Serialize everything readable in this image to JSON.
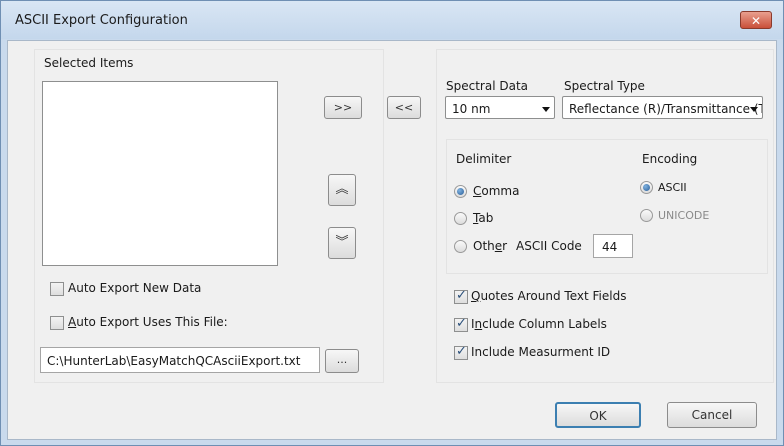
{
  "window": {
    "title": "ASCII Export Configuration",
    "close_glyph": "✕"
  },
  "selected_items": {
    "label": "Selected Items"
  },
  "buttons": {
    "add": ">>",
    "remove": "<<",
    "move_up_glyph": "︽",
    "move_down_glyph": "︾",
    "browse": "...",
    "ok": "OK",
    "cancel": "Cancel"
  },
  "auto_export_new_data": {
    "label": "Auto Export New Data",
    "checked": false
  },
  "auto_export_uses_file": {
    "label_accel": "A",
    "label_rest": "uto Export Uses This File:",
    "checked": false
  },
  "file_path": "C:\\HunterLab\\EasyMatchQCAsciiExport.txt",
  "spectral_data": {
    "label": "Spectral Data",
    "value": "10 nm"
  },
  "spectral_type": {
    "label": "Spectral Type",
    "value": "Reflectance (R)/Transmittance (T)"
  },
  "delimiter": {
    "label": "Delimiter",
    "comma": {
      "accel": "C",
      "rest": "omma",
      "selected": true
    },
    "tab": {
      "accel": "T",
      "rest": "ab",
      "selected": false
    },
    "other": {
      "pre": "Oth",
      "accel": "e",
      "post": "r",
      "selected": false
    },
    "ascii_code_label": "ASCII Code",
    "ascii_code_value": "44"
  },
  "encoding": {
    "label": "Encoding",
    "ascii": {
      "label": "ASCII",
      "selected": true
    },
    "unicode": {
      "label": "UNICODE",
      "selected": false
    }
  },
  "options": {
    "quotes": {
      "accel": "Q",
      "rest": "uotes Around Text Fields",
      "checked": true
    },
    "column_labels": {
      "pre": "I",
      "accel": "n",
      "rest": "clude Column Labels",
      "checked": true
    },
    "measurement_id": {
      "label": "Include Measurment ID",
      "checked": true
    }
  },
  "icons": {
    "close": "close-icon",
    "up": "double-chevron-up-icon",
    "down": "double-chevron-down-icon",
    "dropdown": "chevron-down-icon"
  }
}
